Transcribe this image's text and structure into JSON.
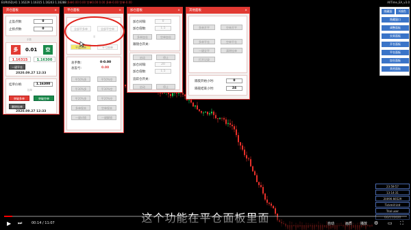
{
  "header": {
    "symbol_line": "EURUSD,H1  1.16229 1.16315 1.16243 1.16288",
    "overlay": "多单0.00 0.00  空单0.00 0.00  多单-0.00  空单-0.00",
    "ea": "AllTime_EA_v3.0"
  },
  "panel_trade": {
    "title": "开仓面板",
    "sl_label": "止盈点数:",
    "sl_value": "0",
    "tp_label": "止损点数:",
    "tp_value": "0",
    "lot_hint": "手数",
    "buy_label": "多",
    "sell_label": "空",
    "spread": "0.01",
    "buy_price": "1.16315",
    "sell_price": "1.16300",
    "close_btn": "一键平仓",
    "date1": "2020.09.27 12:33",
    "pending_label": "挂单价格:",
    "pending_value": "1.16300",
    "pending_hint": "挂单",
    "pend_buy": "突破多单",
    "pend_sell": "突破空单",
    "del_btn": "删除挂单",
    "date2": "2020.09.27 12:33"
  },
  "panel_close": {
    "title": "平仓面板",
    "b1": "全部平多单",
    "b2": "全部平空单",
    "b3": "平盈利单",
    "b4": "平亏损单",
    "sec": "平",
    "total_label": "总手数:",
    "total_value": "0-0.00",
    "profit_label": "总盈亏:",
    "profit_value": "0.00",
    "r1a": "平50%多",
    "r1b": "平50%空",
    "r2a": "平30%多",
    "r2b": "平30%空",
    "r3a": "平20%多",
    "r3b": "平20%空",
    "r4a": "多单保本",
    "r4b": "空单保本",
    "r5a": "一键对锁",
    "r5b": "一键解锁"
  },
  "panel_add": {
    "title": "加仓面板",
    "interval_label": "加仓间隔:",
    "interval_value": "0",
    "times_label": "加仓倍数:",
    "times_value": "1.5",
    "b1": "多单加仓",
    "b2": "空单加仓",
    "sw_label": "跟随仓开关:",
    "b3": "启动",
    "b4": "停止",
    "add2_label": "加仓间隔:",
    "add2_value": "20",
    "times2_label": "加仓倍数:",
    "times2_value": "1.5",
    "b5": "多单加",
    "b6": "空单加",
    "trail_label": "追踪仓开关:",
    "b7": "启动",
    "b8": "停止"
  },
  "panel_other": {
    "title": "其他面板",
    "b1": "多单开平",
    "b2": "空单开平",
    "b3": "多单平仓",
    "b4": "空单平仓",
    "b5": "一键全平",
    "b6": "清除挂单",
    "b7": "打开记录",
    "rollover_label": "隔夜开始小时:",
    "rollover_value": "0",
    "rollend_label": "隔夜结束小时:",
    "rollend_value": "24"
  },
  "right_menu": {
    "t1": "隐藏面",
    "t2": "K线色",
    "items": [
      "隐藏窗口",
      "调整面板",
      "交易面板",
      "开仓面板",
      "平仓面板",
      "加仓面板",
      "其他面板"
    ]
  },
  "right_info": [
    "23:59:57",
    "13:14:31",
    "20090.66529",
    "Tickmill Ltd",
    "Trial user",
    "GG/17/2020"
  ],
  "subtitle": "这个功能在平仓面板里面",
  "video": {
    "time": "00:14 / 11:07",
    "progress": 0.021,
    "auto": "自动",
    "quality": "画质",
    "playlist": "播放"
  }
}
